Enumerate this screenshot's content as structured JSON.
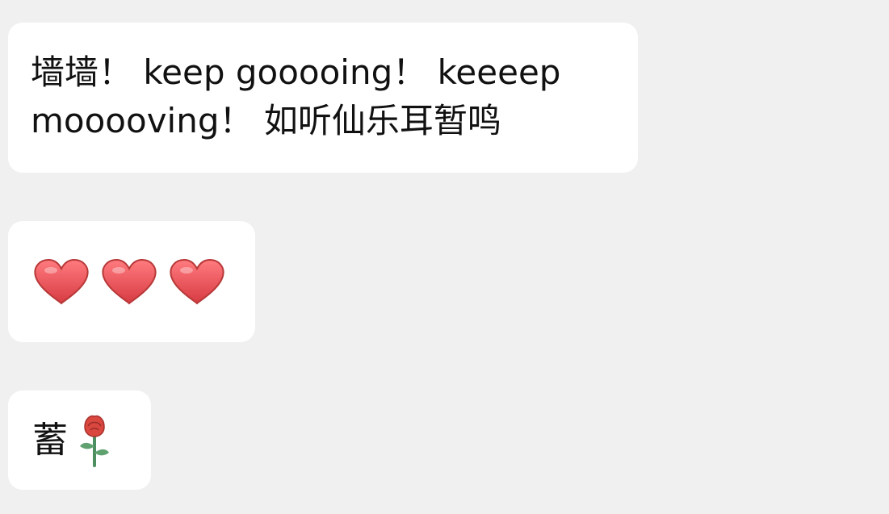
{
  "messages": [
    {
      "type": "text",
      "text": "墙墙！ keep gooooing！ keeeep mooooving！ 如听仙乐耳暂鸣"
    },
    {
      "type": "emoji",
      "icons": [
        "heart-icon",
        "heart-icon",
        "heart-icon"
      ]
    },
    {
      "type": "text-with-emoji",
      "text": "蓄",
      "icon": "rose-icon"
    }
  ],
  "colors": {
    "background": "#f0f0f0",
    "bubble": "#ffffff",
    "text": "#111111",
    "heart": "#e74c4f",
    "rose": "#d9473f",
    "stem": "#4e8f62"
  }
}
